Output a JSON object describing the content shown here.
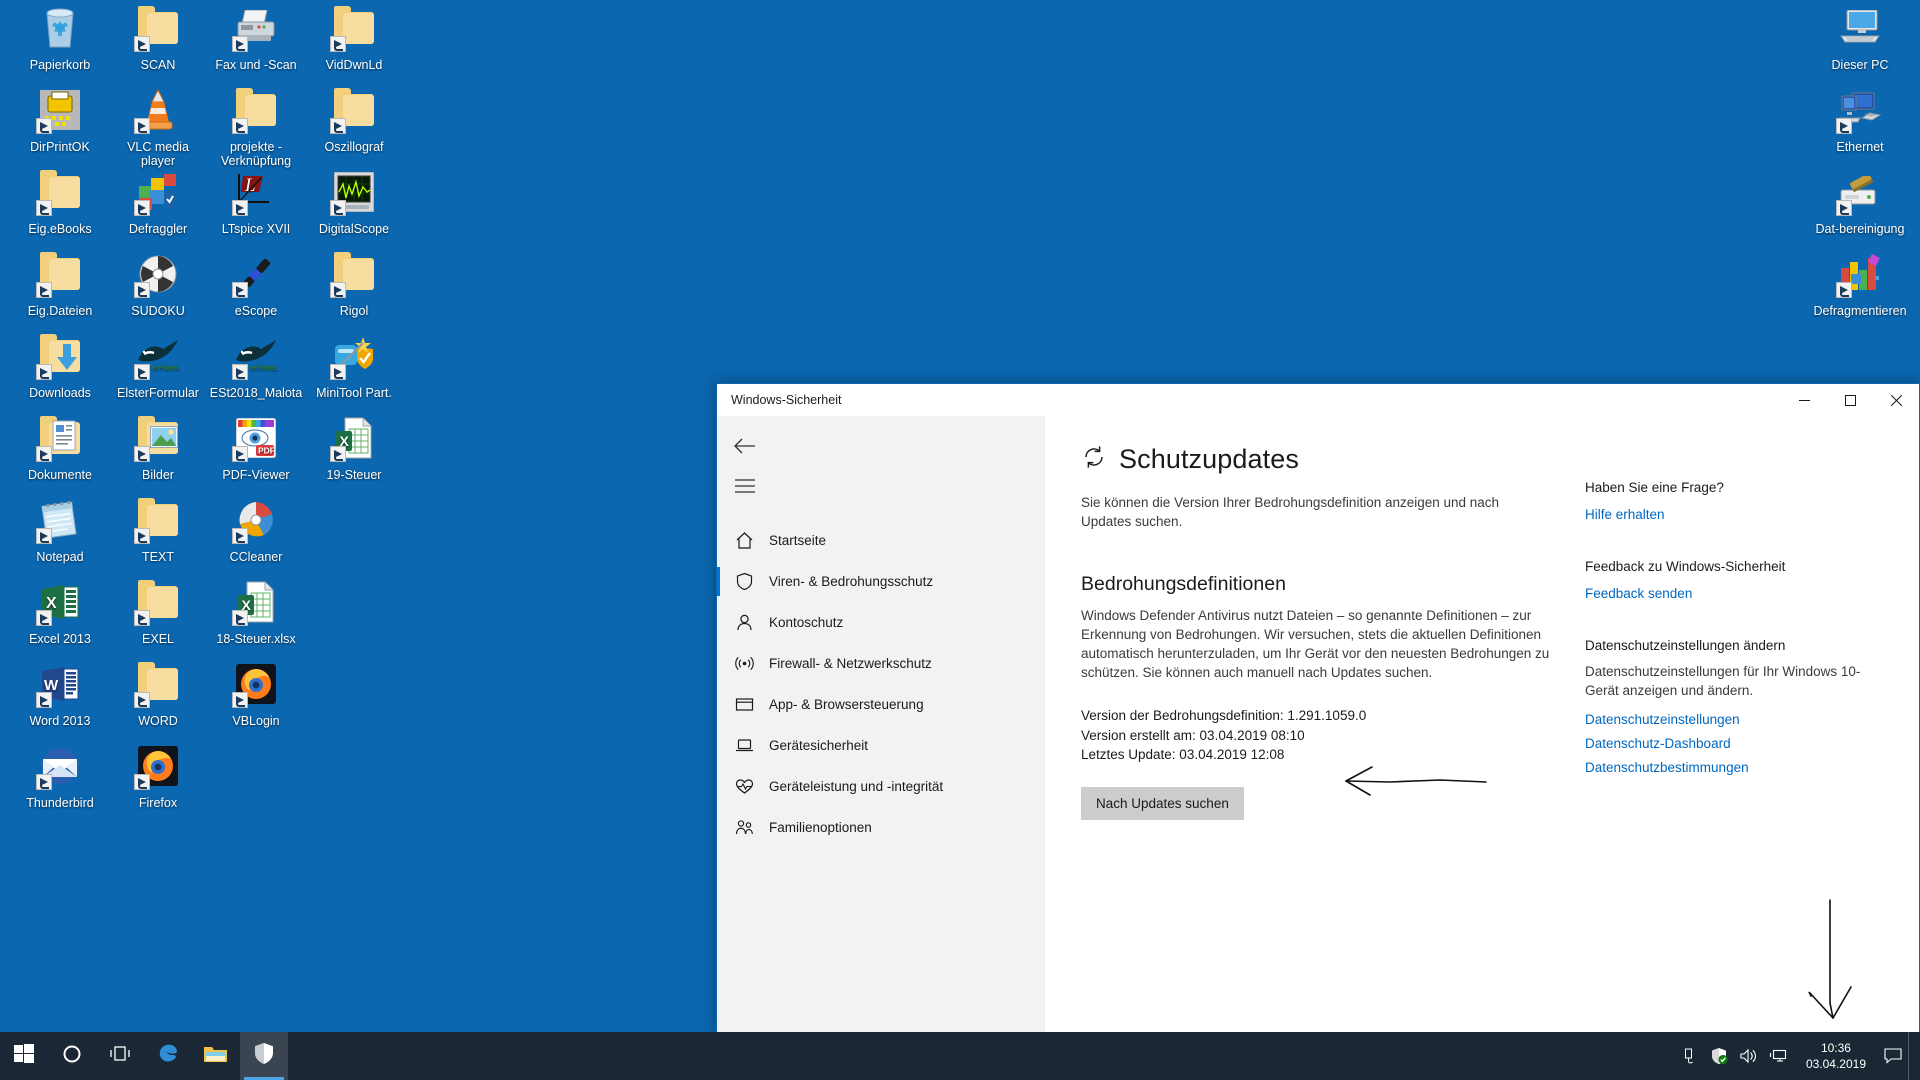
{
  "desktop": {
    "background_color": "#0b67b0",
    "icons_left": [
      {
        "label": "Papierkorb",
        "icon": "recycle-bin-icon",
        "col": 0,
        "row": 0,
        "shortcut": false
      },
      {
        "label": "SCAN",
        "icon": "folder-icon",
        "col": 1,
        "row": 0,
        "shortcut": true
      },
      {
        "label": "Fax und -Scan",
        "icon": "fax-scanner-icon",
        "col": 2,
        "row": 0,
        "shortcut": true
      },
      {
        "label": "VidDwnLd",
        "icon": "folder-icon",
        "col": 3,
        "row": 0,
        "shortcut": true
      },
      {
        "label": "DirPrintOK",
        "icon": "printer-icon",
        "col": 0,
        "row": 1,
        "shortcut": true
      },
      {
        "label": "VLC media player",
        "icon": "vlc-cone-icon",
        "col": 1,
        "row": 1,
        "shortcut": true
      },
      {
        "label": "projekte - Verknüpfung",
        "icon": "folder-icon",
        "col": 2,
        "row": 1,
        "shortcut": true
      },
      {
        "label": "Oszillograf",
        "icon": "folder-icon",
        "col": 3,
        "row": 1,
        "shortcut": true
      },
      {
        "label": "Eig.eBooks",
        "icon": "folder-icon",
        "col": 0,
        "row": 2,
        "shortcut": true
      },
      {
        "label": "Defraggler",
        "icon": "defraggler-cubes-icon",
        "col": 1,
        "row": 2,
        "shortcut": true
      },
      {
        "label": "LTspice XVII",
        "icon": "ltspice-icon",
        "col": 2,
        "row": 2,
        "shortcut": true
      },
      {
        "label": "DigitalScope",
        "icon": "oscilloscope-icon",
        "col": 3,
        "row": 2,
        "shortcut": true
      },
      {
        "label": "Eig.Dateien",
        "icon": "folder-icon",
        "col": 0,
        "row": 3,
        "shortcut": true
      },
      {
        "label": "SUDOKU",
        "icon": "disc-icon",
        "col": 1,
        "row": 3,
        "shortcut": true
      },
      {
        "label": "eScope",
        "icon": "probe-pen-icon",
        "col": 2,
        "row": 3,
        "shortcut": true
      },
      {
        "label": "Rigol",
        "icon": "folder-icon",
        "col": 3,
        "row": 3,
        "shortcut": true
      },
      {
        "label": "Downloads",
        "icon": "downloads-folder-icon",
        "col": 0,
        "row": 4,
        "shortcut": true
      },
      {
        "label": "ElsterFormular",
        "icon": "elster-bird-icon",
        "col": 1,
        "row": 4,
        "shortcut": true
      },
      {
        "label": "ESt2018_Malota",
        "icon": "elster-bird-icon",
        "col": 2,
        "row": 4,
        "shortcut": true
      },
      {
        "label": "MiniTool Part.",
        "icon": "minitool-icon",
        "col": 3,
        "row": 4,
        "shortcut": true
      },
      {
        "label": "Dokumente",
        "icon": "documents-folder-icon",
        "col": 0,
        "row": 5,
        "shortcut": true
      },
      {
        "label": "Bilder",
        "icon": "pictures-folder-icon",
        "col": 1,
        "row": 5,
        "shortcut": true
      },
      {
        "label": "PDF-Viewer",
        "icon": "pdf-viewer-icon",
        "col": 2,
        "row": 5,
        "shortcut": true
      },
      {
        "label": "19-Steuer",
        "icon": "excel-file-icon",
        "col": 3,
        "row": 5,
        "shortcut": true
      },
      {
        "label": "Notepad",
        "icon": "notepad-icon",
        "col": 0,
        "row": 6,
        "shortcut": true
      },
      {
        "label": "TEXT",
        "icon": "folder-icon",
        "col": 1,
        "row": 6,
        "shortcut": true
      },
      {
        "label": "CCleaner",
        "icon": "ccleaner-icon",
        "col": 2,
        "row": 6,
        "shortcut": true
      },
      {
        "label": "Excel 2013",
        "icon": "excel-icon",
        "col": 0,
        "row": 7,
        "shortcut": true
      },
      {
        "label": "EXEL",
        "icon": "folder-icon",
        "col": 1,
        "row": 7,
        "shortcut": true
      },
      {
        "label": "18-Steuer.xlsx",
        "icon": "excel-file-icon",
        "col": 2,
        "row": 7,
        "shortcut": true
      },
      {
        "label": "Word 2013",
        "icon": "word-icon",
        "col": 0,
        "row": 8,
        "shortcut": true
      },
      {
        "label": "WORD",
        "icon": "folder-icon",
        "col": 1,
        "row": 8,
        "shortcut": true
      },
      {
        "label": "VBLogin",
        "icon": "firefox-icon",
        "col": 2,
        "row": 8,
        "shortcut": true
      },
      {
        "label": "Thunderbird",
        "icon": "thunderbird-icon",
        "col": 0,
        "row": 9,
        "shortcut": true
      },
      {
        "label": "Firefox",
        "icon": "firefox-icon",
        "col": 1,
        "row": 9,
        "shortcut": true
      }
    ],
    "icons_right": [
      {
        "label": "Dieser PC",
        "icon": "this-pc-icon",
        "row": 0,
        "shortcut": false
      },
      {
        "label": "Ethernet",
        "icon": "ethernet-icon",
        "row": 1,
        "shortcut": true
      },
      {
        "label": "Dat-bereinigung",
        "icon": "disk-cleanup-icon",
        "row": 2,
        "shortcut": true
      },
      {
        "label": "Defragmentieren",
        "icon": "defrag-icon",
        "row": 3,
        "shortcut": true
      }
    ]
  },
  "window": {
    "title": "Windows-Sicherheit",
    "controls": {
      "minimize": "–",
      "maximize": "□",
      "close": "✕"
    },
    "nav": {
      "back_label": "←",
      "menu_label": "☰",
      "items": [
        {
          "label": "Startseite",
          "icon": "home-icon",
          "active": false
        },
        {
          "label": "Viren- & Bedrohungsschutz",
          "icon": "shield-icon",
          "active": true
        },
        {
          "label": "Kontoschutz",
          "icon": "person-icon",
          "active": false
        },
        {
          "label": "Firewall- & Netzwerkschutz",
          "icon": "wifi-signal-icon",
          "active": false
        },
        {
          "label": "App- & Browsersteuerung",
          "icon": "window-icon",
          "active": false
        },
        {
          "label": "Gerätesicherheit",
          "icon": "laptop-icon",
          "active": false
        },
        {
          "label": "Geräteleistung und -integrität",
          "icon": "heart-icon",
          "active": false
        },
        {
          "label": "Familienoptionen",
          "icon": "family-icon",
          "active": false
        }
      ]
    },
    "main": {
      "page_icon": "refresh-icon",
      "page_title": "Schutzupdates",
      "page_description": "Sie können die Version Ihrer Bedrohungsdefinition anzeigen und nach Updates suchen.",
      "section_title": "Bedrohungsdefinitionen",
      "section_text": "Windows Defender Antivirus nutzt Dateien – so genannte Definitionen – zur Erkennung von Bedrohungen. Wir versuchen, stets die aktuellen Definitionen automatisch herunterzuladen, um Ihr Gerät vor den neuesten Bedrohungen zu schützen. Sie können auch manuell nach Updates suchen.",
      "definition_version_line": "Version der Bedrohungsdefinition: 1.291.1059.0",
      "version_created_line": "Version erstellt am: 03.04.2019 08:10",
      "last_update_line": "Letztes Update: 03.04.2019 12:08",
      "check_updates_button": "Nach Updates suchen"
    },
    "side": {
      "question_heading": "Haben Sie eine Frage?",
      "help_link": "Hilfe erhalten",
      "feedback_heading": "Feedback zu Windows-Sicherheit",
      "feedback_link": "Feedback senden",
      "privacy_heading": "Datenschutzeinstellungen ändern",
      "privacy_text": "Datenschutzeinstellungen für Ihr Windows 10-Gerät anzeigen und ändern.",
      "privacy_links": [
        "Datenschutzeinstellungen",
        "Datenschutz-Dashboard",
        "Datenschutzbestimmungen"
      ]
    }
  },
  "taskbar": {
    "background_color": "#1b2735",
    "buttons": [
      {
        "name": "start-button",
        "icon": "windows-logo-icon",
        "active": false
      },
      {
        "name": "cortana-button",
        "icon": "cortana-circle-icon",
        "active": false
      },
      {
        "name": "task-view-button",
        "icon": "task-view-icon",
        "active": false
      },
      {
        "name": "edge-button",
        "icon": "edge-icon",
        "active": false
      },
      {
        "name": "explorer-button",
        "icon": "file-explorer-icon",
        "active": false
      },
      {
        "name": "windows-security-button",
        "icon": "defender-shield-icon",
        "active": true
      }
    ],
    "tray": [
      {
        "name": "usb-icon",
        "glyph": "usb"
      },
      {
        "name": "defender-shield-ok-icon",
        "glyph": "shield-check"
      },
      {
        "name": "volume-icon",
        "glyph": "speaker"
      },
      {
        "name": "network-icon",
        "glyph": "monitor"
      }
    ],
    "clock_time": "10:36",
    "clock_date": "03.04.2019",
    "action_center_icon": "notification-icon"
  },
  "annotations": {
    "arrow_to_last_update": "hand-drawn-arrow-left",
    "arrow_bottom_right": "hand-drawn-arrow-down"
  }
}
